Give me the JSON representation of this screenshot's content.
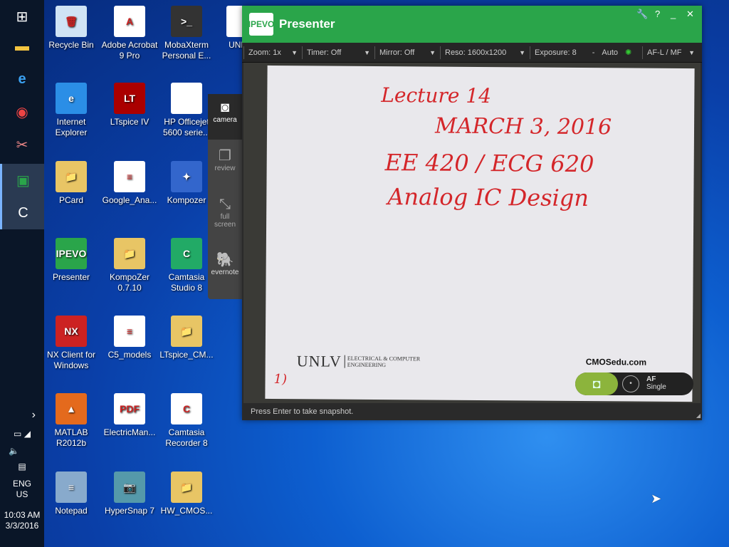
{
  "taskbar": {
    "items": [
      "windows-start",
      "file-explorer",
      "internet-explorer",
      "chrome",
      "snipping",
      "presenter",
      "camtasia"
    ],
    "tray": {
      "expand": "›",
      "language": "ENG",
      "region": "US",
      "time": "10:03 AM",
      "date": "3/3/2016"
    }
  },
  "desktop": {
    "icons": [
      {
        "label": "Recycle Bin",
        "glyph": "🗑",
        "color": "#cfe3f5"
      },
      {
        "label": "Internet Explorer",
        "glyph": "e",
        "color": "#2b8ee6"
      },
      {
        "label": "PCard",
        "glyph": "📁",
        "color": "#e8c565"
      },
      {
        "label": "Presenter",
        "glyph": "IPEVO",
        "color": "#2aa54a"
      },
      {
        "label": "NX Client for Windows",
        "glyph": "NX",
        "color": "#c22"
      },
      {
        "label": "MATLAB R2012b",
        "glyph": "▲",
        "color": "#e46a1d"
      },
      {
        "label": "Notepad",
        "glyph": "≡",
        "color": "#8ac"
      },
      {
        "label": "Adobe Acrobat 9 Pro",
        "glyph": "A",
        "color": "#fff"
      },
      {
        "label": "LTspice IV",
        "glyph": "LT",
        "color": "#a00"
      },
      {
        "label": "Google_Ana...",
        "glyph": "≡",
        "color": "#fff"
      },
      {
        "label": "KompoZer 0.7.10",
        "glyph": "📁",
        "color": "#e8c565"
      },
      {
        "label": "C5_models",
        "glyph": "≡",
        "color": "#fff"
      },
      {
        "label": "ElectricMan...",
        "glyph": "PDF",
        "color": "#fff"
      },
      {
        "label": "HyperSnap 7",
        "glyph": "📷",
        "color": "#59a"
      },
      {
        "label": "MobaXterm Personal E...",
        "glyph": ">_",
        "color": "#333"
      },
      {
        "label": "HP Officejet 5600 serie...",
        "glyph": "",
        "color": "#fff"
      },
      {
        "label": "Kompozer",
        "glyph": "✦",
        "color": "#36c"
      },
      {
        "label": "Camtasia Studio 8",
        "glyph": "C",
        "color": "#2a6"
      },
      {
        "label": "LTspice_CM...",
        "glyph": "📁",
        "color": "#e8c565"
      },
      {
        "label": "Camtasia Recorder 8",
        "glyph": "C",
        "color": "#fff"
      },
      {
        "label": "HW_CMOS...",
        "glyph": "📁",
        "color": "#e8c565"
      },
      {
        "label": "UNLV_",
        "glyph": "",
        "color": "#fff"
      }
    ]
  },
  "side_panel": {
    "camera": "camera",
    "review": "review",
    "fullscreen": "full screen",
    "evernote": "evernote"
  },
  "presenter": {
    "logo": "IPEVO",
    "title": "Presenter",
    "accent": "#2aa54a",
    "toolbar": {
      "zoom": "Zoom: 1x",
      "timer": "Timer: Off",
      "mirror": "Mirror: Off",
      "reso": "Reso: 1600x1200",
      "exposure": "Exposure: 8",
      "minus": "-",
      "auto": "Auto",
      "focus": "AF-L / MF"
    },
    "paper": {
      "line1": "Lecture 14",
      "line2": "MARCH 3, 2016",
      "line3": "EE 420 / ECG 620",
      "line4": "Analog IC Design",
      "corner": "1)",
      "brand": "UNLV",
      "dept": "ELECTRICAL & COMPUTER ENGINEERING",
      "site": "CMOSedu.com"
    },
    "af": {
      "title": "AF",
      "mode": "Single"
    },
    "status": "Press Enter to take snapshot."
  }
}
